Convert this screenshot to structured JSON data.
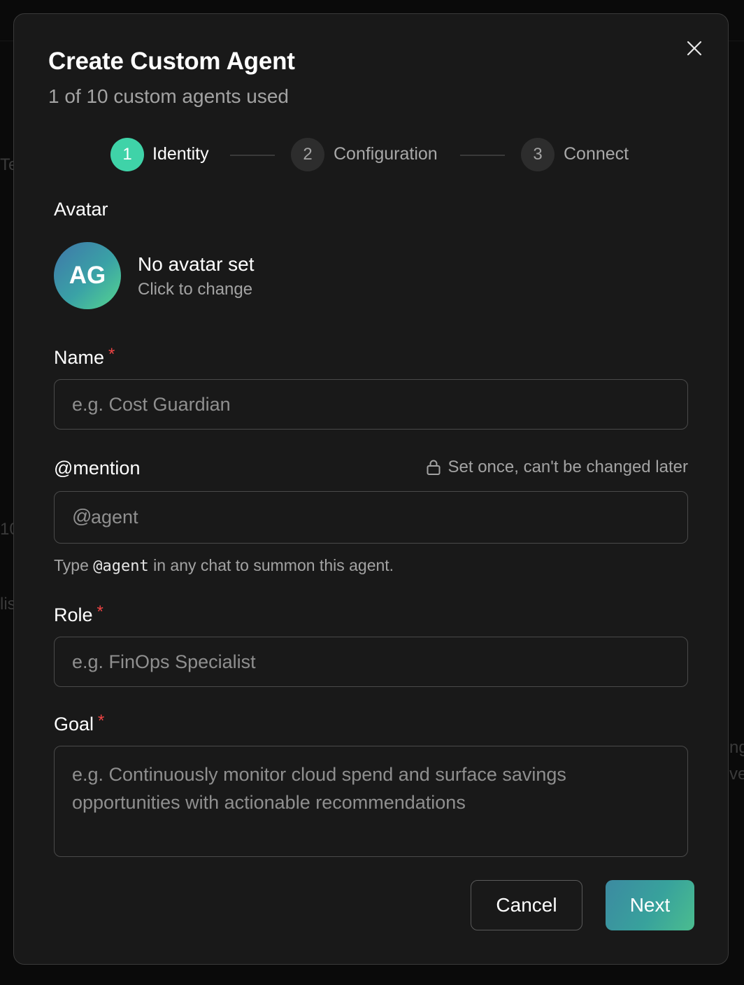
{
  "modal": {
    "title": "Create Custom Agent",
    "subtitle": "1 of 10 custom agents used",
    "close_icon": "close-icon"
  },
  "stepper": {
    "steps": [
      {
        "number": "1",
        "label": "Identity",
        "state": "active"
      },
      {
        "number": "2",
        "label": "Configuration",
        "state": "inactive"
      },
      {
        "number": "3",
        "label": "Connect",
        "state": "inactive"
      }
    ],
    "active_color": "#3fd3a8"
  },
  "avatar": {
    "label": "Avatar",
    "initials": "AG",
    "status": "No avatar set",
    "hint": "Click to change"
  },
  "name_field": {
    "label": "Name",
    "required_mark": "*",
    "placeholder": "e.g. Cost Guardian",
    "value": ""
  },
  "mention_field": {
    "label": "@mention",
    "lock_note": "Set once, can't be changed later",
    "lock_icon": "lock-icon",
    "prefix": "@",
    "placeholder": "agent",
    "value": "",
    "helper_before": "Type",
    "helper_code": "@agent",
    "helper_after": "in any chat to summon this agent."
  },
  "role_field": {
    "label": "Role",
    "required_mark": "*",
    "placeholder": "e.g. FinOps Specialist",
    "value": ""
  },
  "goal_field": {
    "label": "Goal",
    "required_mark": "*",
    "placeholder": "e.g. Continuously monitor cloud spend and surface savings opportunities with actionable recommendations",
    "value": ""
  },
  "actions": {
    "cancel_label": "Cancel",
    "next_label": "Next"
  },
  "colors": {
    "background": "#0a0a0a",
    "modal_background": "#191919",
    "required": "#ef4444"
  }
}
